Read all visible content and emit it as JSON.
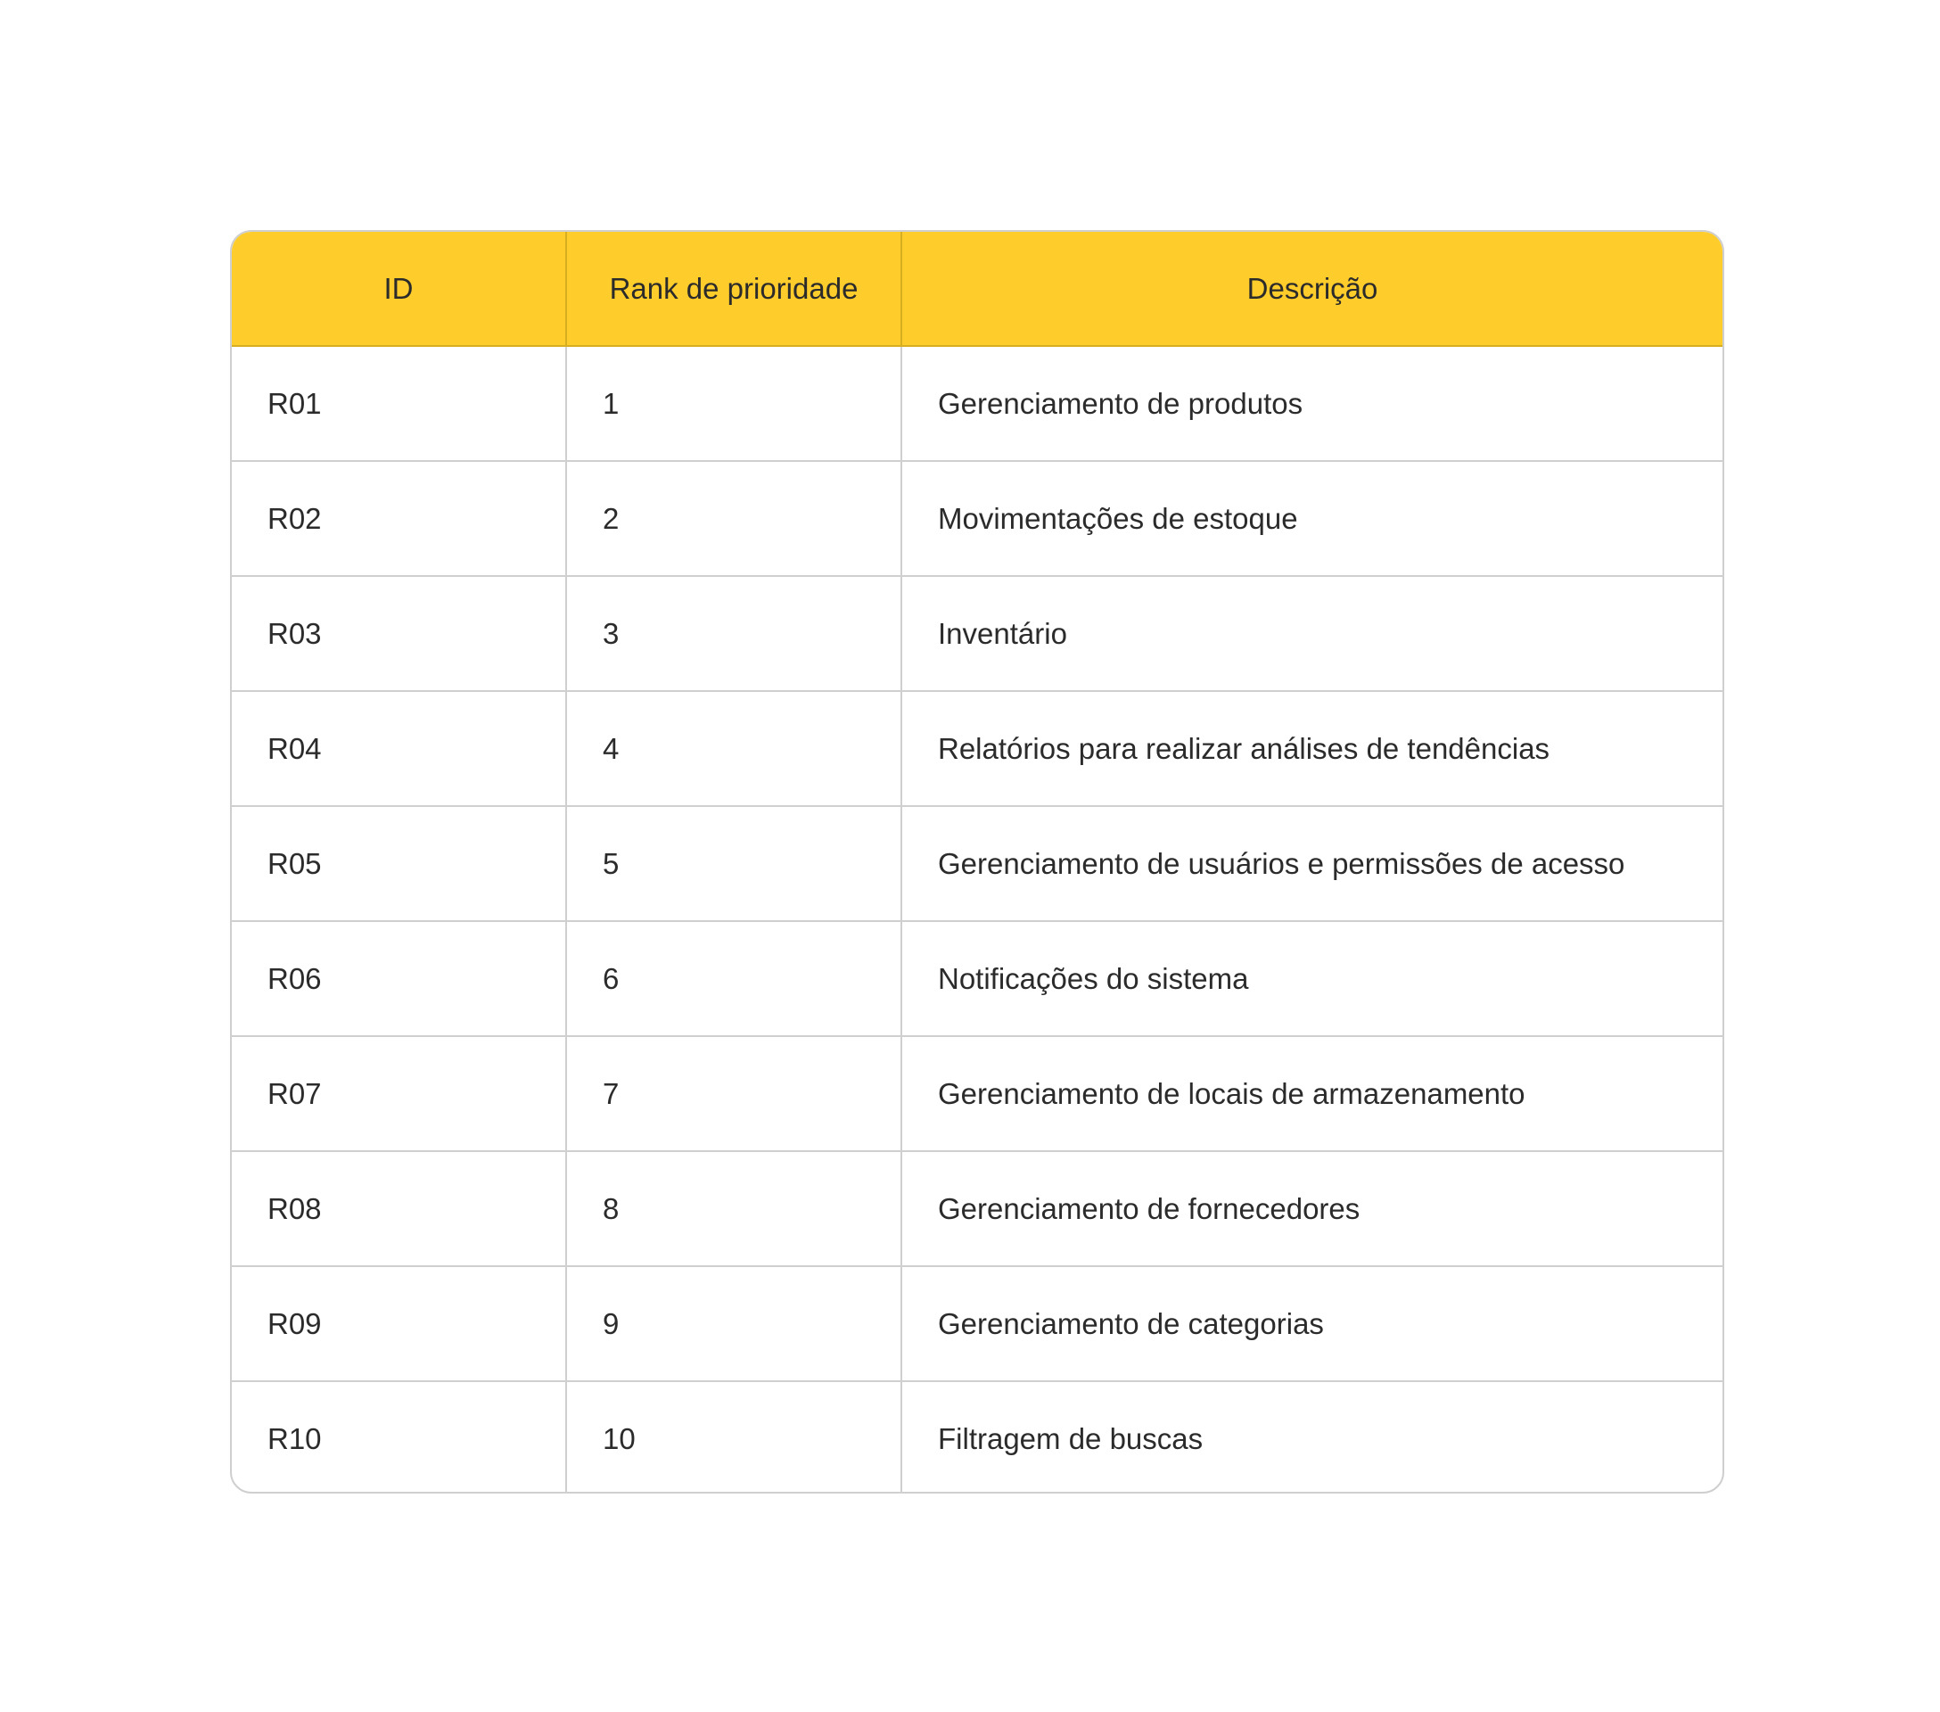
{
  "table": {
    "headers": {
      "id": "ID",
      "rank": "Rank de prioridade",
      "description": "Descrição"
    },
    "rows": [
      {
        "id": "R01",
        "rank": "1",
        "description": "Gerenciamento de produtos"
      },
      {
        "id": "R02",
        "rank": "2",
        "description": "Movimentações de estoque"
      },
      {
        "id": "R03",
        "rank": "3",
        "description": "Inventário"
      },
      {
        "id": "R04",
        "rank": "4",
        "description": "Relatórios para realizar análises de tendências"
      },
      {
        "id": "R05",
        "rank": "5",
        "description": "Gerenciamento de usuários e permissões de acesso"
      },
      {
        "id": "R06",
        "rank": "6",
        "description": "Notificações do sistema"
      },
      {
        "id": "R07",
        "rank": "7",
        "description": "Gerenciamento de  locais de armazenamento"
      },
      {
        "id": "R08",
        "rank": "8",
        "description": "Gerenciamento de fornecedores"
      },
      {
        "id": "R09",
        "rank": "9",
        "description": "Gerenciamento de categorias"
      },
      {
        "id": "R10",
        "rank": "10",
        "description": "Filtragem de buscas"
      }
    ]
  },
  "colors": {
    "header_background": "#ffcd2b",
    "border": "#cfcfcf",
    "text": "#2b2b2b"
  }
}
